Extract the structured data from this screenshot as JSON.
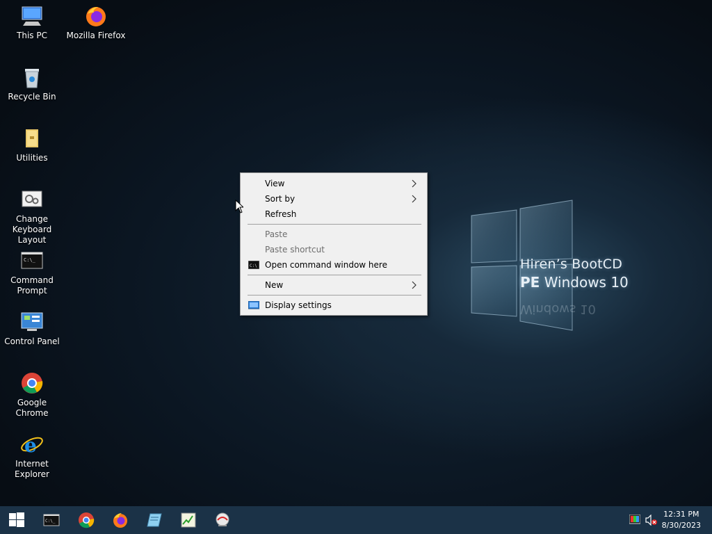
{
  "desktop": {
    "icons": [
      {
        "label": "This PC"
      },
      {
        "label": "Mozilla Firefox"
      },
      {
        "label": "Recycle Bin"
      },
      {
        "label": "Utilities"
      },
      {
        "label": "Change Keyboard Layout"
      },
      {
        "label": "Command Prompt"
      },
      {
        "label": "Control Panel"
      },
      {
        "label": "Google Chrome"
      },
      {
        "label": "Internet Explorer"
      }
    ],
    "wallpaper": {
      "line1": "Hiren’s BootCD",
      "line2_bold": "PE",
      "line2_rest": "Windows 10",
      "reflection": "Windows 10"
    }
  },
  "context_menu": {
    "items": [
      {
        "label": "View",
        "submenu": true
      },
      {
        "label": "Sort by",
        "submenu": true
      },
      {
        "label": "Refresh"
      },
      {
        "label": "Paste",
        "disabled": true
      },
      {
        "label": "Paste shortcut",
        "disabled": true
      },
      {
        "label": "Open command window here",
        "icon": "command-prompt-icon"
      },
      {
        "label": "New",
        "submenu": true
      },
      {
        "label": "Display settings",
        "icon": "display-icon"
      }
    ]
  },
  "taskbar": {
    "buttons": [
      "start-windows-icon",
      "command-prompt-icon",
      "chrome-icon",
      "firefox-icon",
      "notepad-icon",
      "task-chart-icon",
      "network-icon"
    ],
    "tray": {
      "time": "12:31 PM",
      "date": "8/30/2023",
      "icons": [
        "display-color-icon",
        "volume-muted-icon"
      ]
    }
  },
  "colors": {
    "taskbar": "#1b3247",
    "menu_bg": "#f0f0f0",
    "menu_disabled_text": "#6d6d6d"
  }
}
